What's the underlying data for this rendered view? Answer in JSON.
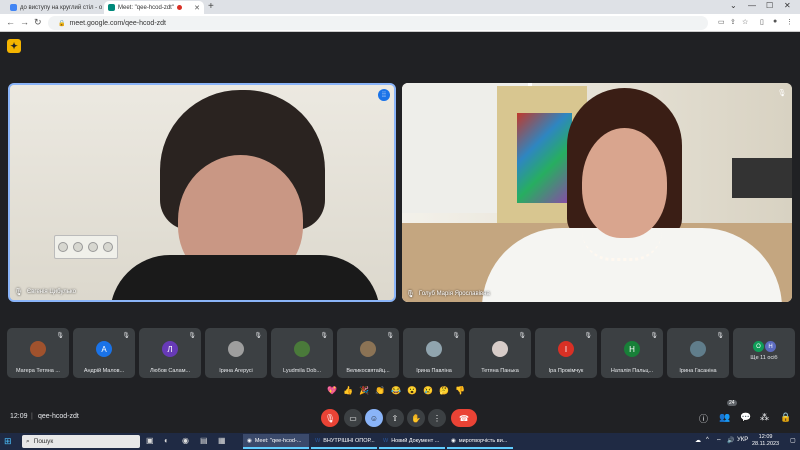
{
  "browser": {
    "tabs": [
      {
        "label": "до виступу на круглий стіл - о",
        "active": false
      },
      {
        "label": "Meet: \"qee-hcod-zdt\"",
        "active": true
      }
    ],
    "url": "meet.google.com/qee-hcod-zdt"
  },
  "meet": {
    "main_tiles": [
      {
        "name": "Євгенія Цибулько",
        "status": "speaking"
      },
      {
        "name": "Голуб Марія Ярославівна",
        "status": "muted"
      }
    ],
    "participants": [
      {
        "name": "Магера Тетяна ...",
        "avatar_letter": "",
        "avatar_color": "#a0522d"
      },
      {
        "name": "Андрій Малов...",
        "avatar_letter": "А",
        "avatar_color": "#1a73e8"
      },
      {
        "name": "Любов Салам...",
        "avatar_letter": "Л",
        "avatar_color": "#673ab7"
      },
      {
        "name": "Ірина Агерусі",
        "avatar_letter": "",
        "avatar_color": "#9e9e9e"
      },
      {
        "name": "Lyudmila Dob...",
        "avatar_letter": "",
        "avatar_color": "#4a7a3a"
      },
      {
        "name": "Великосвятайц...",
        "avatar_letter": "",
        "avatar_color": "#8b7355"
      },
      {
        "name": "Ірина Павліна",
        "avatar_letter": "",
        "avatar_color": "#90a4ae"
      },
      {
        "name": "Тетяна Панька",
        "avatar_letter": "",
        "avatar_color": "#d7ccc8"
      },
      {
        "name": "Іра Прокімчук",
        "avatar_letter": "І",
        "avatar_color": "#d93025"
      },
      {
        "name": "Наталія Пальц...",
        "avatar_letter": "Н",
        "avatar_color": "#188038"
      },
      {
        "name": "Ірина Гасаніна",
        "avatar_letter": "",
        "avatar_color": "#607d8b"
      }
    ],
    "others": {
      "label": "Ще 11 осіб",
      "letters": [
        "О",
        "Н"
      ],
      "colors": [
        "#0f9d58",
        "#5c6bc0"
      ]
    },
    "reactions": [
      "💖",
      "👍",
      "🎉",
      "👏",
      "😂",
      "😮",
      "😢",
      "🤔",
      "👎"
    ],
    "bottom": {
      "time": "12:09",
      "separator": "|",
      "code": "qee-hcod-zdt",
      "participant_count": "24"
    }
  },
  "taskbar": {
    "search_placeholder": "Пошук",
    "apps": [
      {
        "label": "Meet: \"qee-hcod-...",
        "active": true
      },
      {
        "label": "ВНУТРІШНІ ОПОР...",
        "active": false
      },
      {
        "label": "Новий Документ ...",
        "active": false
      },
      {
        "label": "миротворчість ви...",
        "active": false
      }
    ],
    "language": "УКР",
    "clock_time": "12:09",
    "clock_date": "28.11.2023"
  },
  "colors": {
    "accent": "#8ab4f8",
    "hangup": "#ea4335",
    "meet_bg": "#202124",
    "tile_bg": "#3c4043"
  }
}
